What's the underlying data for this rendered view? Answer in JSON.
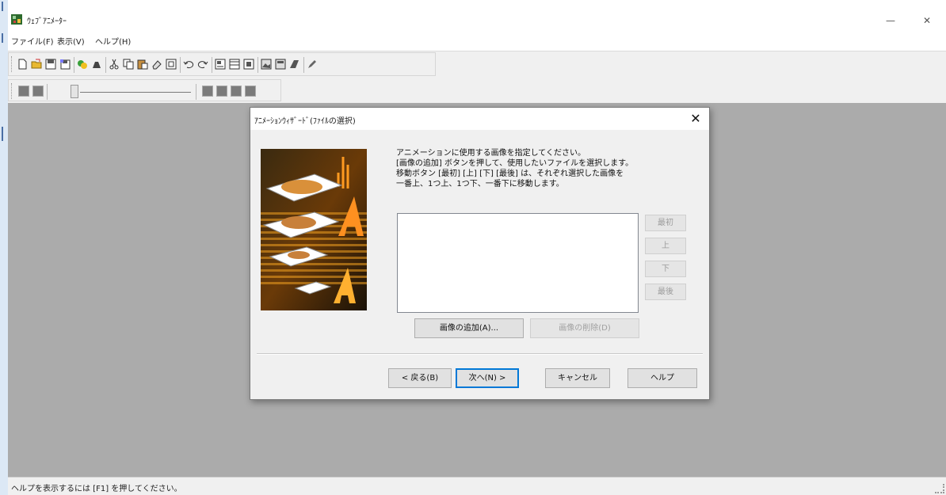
{
  "app": {
    "title": "ｳｪﾌﾞｱﾆﾒｰﾀｰ",
    "minimize_label": "—",
    "close_label": "✕"
  },
  "menu": {
    "items": [
      "ファイル(F)",
      "表示(V)",
      "ヘルプ(H)"
    ]
  },
  "toolbar": {
    "icons": [
      "new-icon",
      "open-icon",
      "save-icon",
      "save-as-icon",
      "effects-icon",
      "paint-icon",
      "cut-icon",
      "copy-icon",
      "paste-icon",
      "clear-icon",
      "frame-icon",
      "undo-icon",
      "redo-icon",
      "properties-icon",
      "panel-icon",
      "preview-icon",
      "image-list-icon",
      "animation-icon",
      "wizard-icon",
      "pen-icon"
    ]
  },
  "playback_toolbar": {
    "icons": [
      "first-frame-icon",
      "previous-frame-icon",
      "play-icon",
      "stop-icon",
      "next-frame-icon",
      "last-frame-icon"
    ]
  },
  "dialog": {
    "title": "ｱﾆﾒｰｼｮﾝｳｨｻﾞｰﾄﾞ(ﾌｧｲﾙの選択)",
    "close_label": "✕",
    "instructions": [
      "アニメーションに使用する画像を指定してください。",
      "[画像の追加] ボタンを押して、使用したいファイルを選択します。",
      "移動ボタン [最初] [上] [下] [最後] は、それぞれ選択した画像を",
      "一番上、1つ上、1つ下、一番下に移動します。"
    ],
    "move_buttons": {
      "first": "最初",
      "up": "上",
      "down": "下",
      "last": "最後"
    },
    "add_image_label": "画像の追加(A)...",
    "delete_image_label": "画像の削除(D)",
    "back_label": "< 戻る(B)",
    "next_label": "次へ(N) >",
    "cancel_label": "キャンセル",
    "help_label": "ヘルプ"
  },
  "status_bar": {
    "text": "ヘルプを表示するには [F1] を押してください。"
  },
  "colors": {
    "workspace": "#ababab",
    "accent": "#0078d7"
  }
}
